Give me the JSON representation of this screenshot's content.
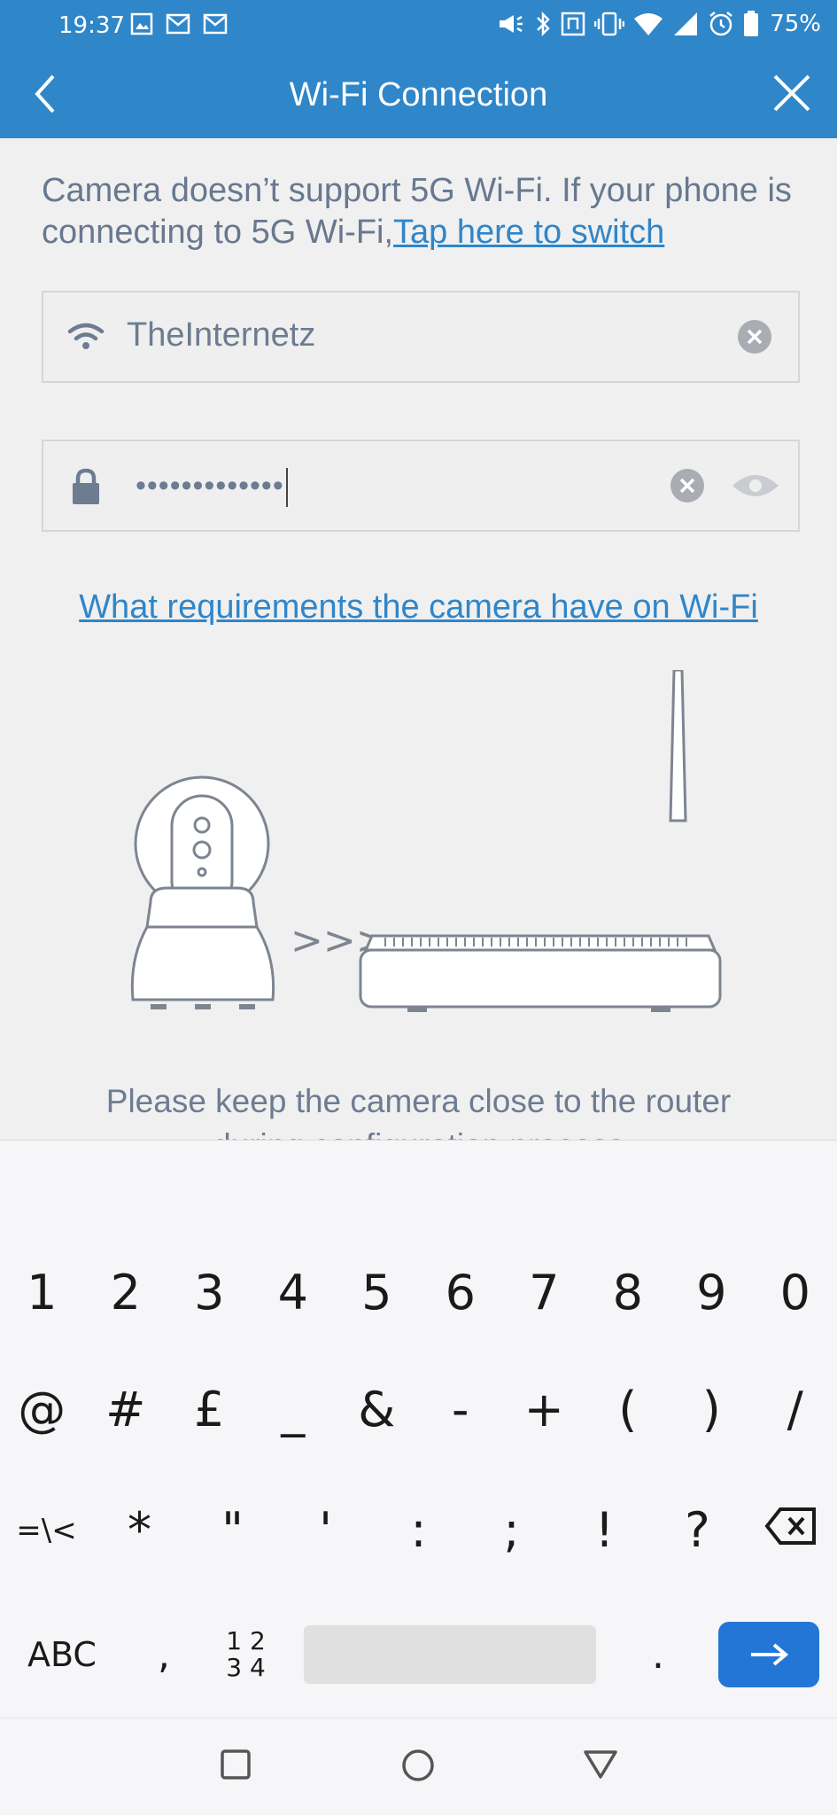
{
  "status_bar": {
    "time": "19:37",
    "battery_percent": "75%",
    "left_icons": [
      "gallery-icon",
      "gmail-icon",
      "gmail-icon"
    ],
    "right_icons": [
      "megaphone-icon",
      "bluetooth-icon",
      "nfc-icon",
      "vibrate-icon",
      "wifi-icon",
      "signal-icon",
      "alarm-icon",
      "battery-icon"
    ]
  },
  "header": {
    "title": "Wi-Fi Connection",
    "back_icon": "chevron-left-icon",
    "close_icon": "close-icon"
  },
  "notice": {
    "text": "Camera doesn’t support 5G Wi-Fi. If your phone is connecting to 5G Wi-Fi,",
    "link": "Tap here to switch"
  },
  "ssid_field": {
    "value": "TheInternetz",
    "icon": "wifi-icon"
  },
  "password_field": {
    "masked_value": "•••••••••••••",
    "icon": "lock-icon"
  },
  "requirements_link": "What requirements the camera have on Wi-Fi",
  "illustration": {
    "arrows": ">>>"
  },
  "hint": {
    "line1": "Please keep the camera close to the router",
    "line2": "during configuration process"
  },
  "keyboard": {
    "row1": [
      "1",
      "2",
      "3",
      "4",
      "5",
      "6",
      "7",
      "8",
      "9",
      "0"
    ],
    "row2": [
      "@",
      "#",
      "£",
      "_",
      "&",
      "-",
      "+",
      "(",
      ")",
      "/"
    ],
    "row3": [
      "=\\<",
      "*",
      "\"",
      "'",
      ":",
      ";",
      "!",
      "?"
    ],
    "abc": "ABC",
    "comma": ",",
    "num_top": "1 2",
    "num_bottom": "3 4",
    "period": "."
  },
  "colors": {
    "accent": "#2f86c9",
    "enter_key": "#2476d6"
  }
}
